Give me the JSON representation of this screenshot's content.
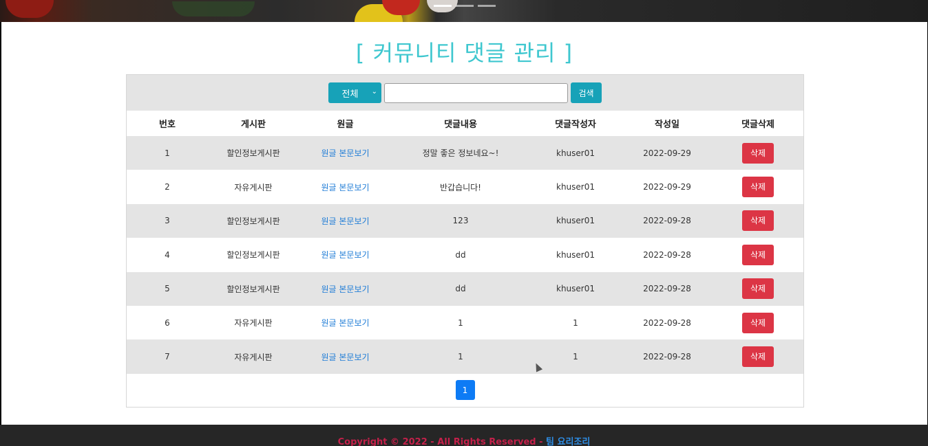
{
  "page_title": "[ 커뮤니티 댓글 관리 ]",
  "search": {
    "select_value": "전체",
    "input_value": "",
    "button_label": "검색"
  },
  "table": {
    "headers": [
      "번호",
      "게시판",
      "원글",
      "댓글내용",
      "댓글작성자",
      "작성일",
      "댓글삭제"
    ],
    "rows": [
      {
        "no": "1",
        "board": "할인정보게시판",
        "link": "원글 본문보기",
        "content": "정말 좋은 정보네요~!",
        "author": "khuser01",
        "date": "2022-09-29",
        "delete": "삭제"
      },
      {
        "no": "2",
        "board": "자유게시판",
        "link": "원글 본문보기",
        "content": "반갑습니다!",
        "author": "khuser01",
        "date": "2022-09-29",
        "delete": "삭제"
      },
      {
        "no": "3",
        "board": "할인정보게시판",
        "link": "원글 본문보기",
        "content": "123",
        "author": "khuser01",
        "date": "2022-09-28",
        "delete": "삭제"
      },
      {
        "no": "4",
        "board": "할인정보게시판",
        "link": "원글 본문보기",
        "content": "dd",
        "author": "khuser01",
        "date": "2022-09-28",
        "delete": "삭제"
      },
      {
        "no": "5",
        "board": "할인정보게시판",
        "link": "원글 본문보기",
        "content": "dd",
        "author": "khuser01",
        "date": "2022-09-28",
        "delete": "삭제"
      },
      {
        "no": "6",
        "board": "자유게시판",
        "link": "원글 본문보기",
        "content": "1",
        "author": "1",
        "date": "2022-09-28",
        "delete": "삭제"
      },
      {
        "no": "7",
        "board": "자유게시판",
        "link": "원글 본문보기",
        "content": "1",
        "author": "1",
        "date": "2022-09-28",
        "delete": "삭제"
      }
    ]
  },
  "pagination": {
    "current": "1"
  },
  "footer": {
    "copyright": "Copyright © 2022 - All Rights Reserved - ",
    "team": "팀 요리조리"
  },
  "colors": {
    "title": "#3ec7cf",
    "info_button": "#17a2b8",
    "delete_button": "#dc3545",
    "page_active": "#0d7bf5",
    "link": "#1d7bd6",
    "footer_copy": "#c4204a",
    "footer_team": "#2e8ee6"
  },
  "icons": {
    "select_arrow": "chevron-down-icon"
  }
}
